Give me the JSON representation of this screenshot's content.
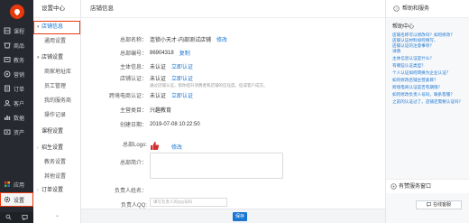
{
  "rail": {
    "items": [
      {
        "label": "课程",
        "icon": "course-icon"
      },
      {
        "label": "商品",
        "icon": "goods-icon"
      },
      {
        "label": "教务",
        "icon": "teaching-icon"
      },
      {
        "label": "营销",
        "icon": "marketing-icon"
      },
      {
        "label": "订单",
        "icon": "order-icon"
      },
      {
        "label": "客户",
        "icon": "customer-icon"
      },
      {
        "label": "数据",
        "icon": "data-icon"
      },
      {
        "label": "资产",
        "icon": "asset-icon"
      }
    ],
    "bottom_items": [
      {
        "label": "应用",
        "icon": "apps-icon"
      },
      {
        "label": "设置",
        "icon": "gear-icon"
      }
    ]
  },
  "submenu": {
    "title": "设置中心",
    "groups": [
      {
        "label": "店铺信息",
        "items": [
          "通用设置"
        ]
      },
      {
        "label": "店铺设置",
        "items": [
          "商家地址库",
          "员工管理",
          "我的服务商",
          "操作记录"
        ]
      },
      {
        "label": "课程设置",
        "items": []
      },
      {
        "label": "招生设置",
        "items": [
          "教务设置",
          "其他设置"
        ]
      },
      {
        "label": "订单设置",
        "items": []
      }
    ]
  },
  "main": {
    "title": "店铺信息",
    "fields": {
      "name_label": "总部名称：",
      "name_value": "连锁小天才-内部测试店铺",
      "name_action": "修改",
      "id_label": "总部编号：",
      "id_value": "86904318",
      "id_action": "复制",
      "subject_label": "主体信息：",
      "subject_value": "未认证",
      "subject_action": "立即认证",
      "store_cert_label": "店铺认证：",
      "store_cert_value": "未认证",
      "store_cert_action": "立即认证",
      "store_cert_note": "通过店铺认证，帮你提升消费者和店铺的信任度，促成客户成交。",
      "cross_label": "跨境电商认证：",
      "cross_value": "未认证",
      "cross_action": "立即认证",
      "category_label": "主营类目：",
      "category_value": "兴趣教育",
      "created_label": "创建日期：",
      "created_value": "2019-07-08 10:22:50",
      "logo_label": "总部Logo:",
      "logo_action": "修改",
      "intro_label": "总部简介：",
      "owner_label": "负责人姓名：",
      "owner_qq_label": "负责人QQ:",
      "owner_qq_placeholder": "填写负责人的QQ号码"
    },
    "save_label": "保存"
  },
  "help": {
    "title": "帮助和服务",
    "center_title": "帮助中心",
    "links": [
      "店铺名称可以修改吗？如何修改？",
      "店铺认证材料如何填写、",
      "店铺认证的注意事项？",
      "详情",
      "主体信息认证是什么？",
      "有哪些认证类型？",
      "个人认证如何转换为企业认证？",
      "如何修改店铺主营类目？",
      "跨境电商认证是否有期限？",
      "如何修改负责人号码，联系客服？",
      "之前的认证过了，店铺还需要认证吗？"
    ],
    "service_title": "有赞服务窗口",
    "cs_label": "在线客服"
  }
}
